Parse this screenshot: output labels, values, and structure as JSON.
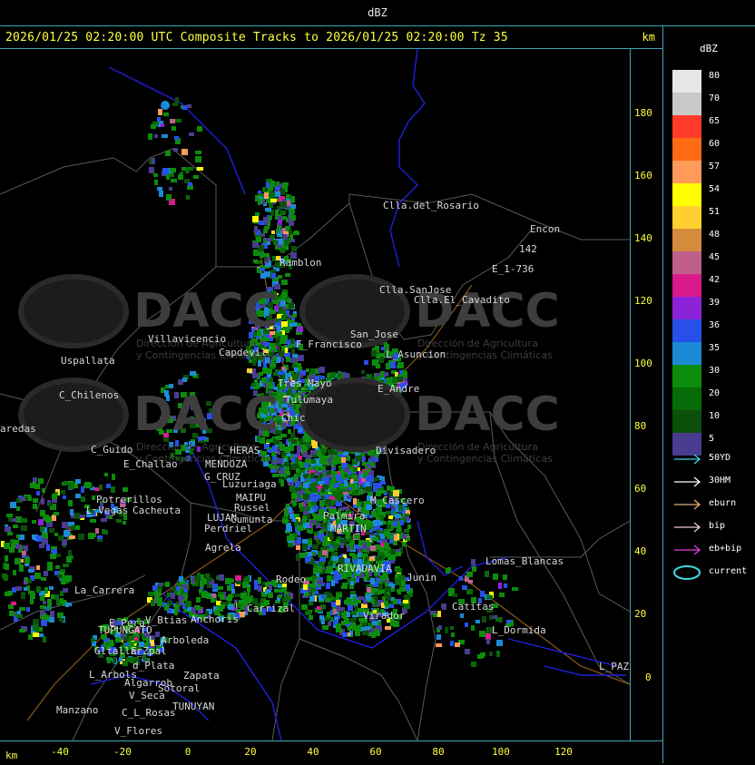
{
  "top_title": "dBZ",
  "header": {
    "text": "2026/01/25 02:20:00 UTC Composite Tracks to 2026/01/25 02:20:00 Tz 35",
    "unit": "km"
  },
  "axes": {
    "x_unit": "km",
    "x_ticks": [
      "-40",
      "-20",
      "0",
      "20",
      "40",
      "60",
      "80",
      "100",
      "120"
    ],
    "y_ticks": [
      "180",
      "160",
      "140",
      "120",
      "100",
      "80",
      "60",
      "40",
      "20",
      "0"
    ]
  },
  "legend": {
    "title": "dBZ",
    "scale": [
      {
        "label": "80",
        "color": "#e6e6e6"
      },
      {
        "label": "70",
        "color": "#c8c8c8"
      },
      {
        "label": "65",
        "color": "#ff3a28"
      },
      {
        "label": "60",
        "color": "#ff6a14"
      },
      {
        "label": "57",
        "color": "#ff9a5a"
      },
      {
        "label": "54",
        "color": "#ffff00"
      },
      {
        "label": "51",
        "color": "#ffd030"
      },
      {
        "label": "48",
        "color": "#d48c3c"
      },
      {
        "label": "45",
        "color": "#c0608a"
      },
      {
        "label": "42",
        "color": "#d81a8c"
      },
      {
        "label": "39",
        "color": "#8c22d8"
      },
      {
        "label": "36",
        "color": "#2650e8"
      },
      {
        "label": "35",
        "color": "#1c8ad6"
      },
      {
        "label": "30",
        "color": "#0c8c0c"
      },
      {
        "label": "20",
        "color": "#066a06"
      },
      {
        "label": "10",
        "color": "#0a500a"
      },
      {
        "label": "5",
        "color": "#4a3c90"
      }
    ],
    "tracks": [
      {
        "label": "50YD",
        "color": "#40d0e0"
      },
      {
        "label": "30HM",
        "color": "#ffffff"
      },
      {
        "label": "eburn",
        "color": "#e0b070"
      },
      {
        "label": "bip",
        "color": "#f0c8e0"
      },
      {
        "label": "eb+bip",
        "color": "#e040e0"
      },
      {
        "label": "current",
        "color": "#40d8e0"
      }
    ]
  },
  "watermarks": [
    {
      "name": "DACC",
      "line1": "Dirección de Agricultura",
      "line2": "y Contingencias Climáticas"
    },
    {
      "name": "DACC",
      "line1": "Dirección de Agricultura",
      "line2": "y Contingencias Climáticas"
    },
    {
      "name": "DACC",
      "line1": "Dirección de Agricultura",
      "line2": "y Contingencias Climáticas"
    },
    {
      "name": "DACC",
      "line1": "Dirección de Agricultura",
      "line2": "y Contingencias Climáticas"
    }
  ],
  "places": [
    "Clla.del_Rosario",
    "Encon",
    "142",
    "E_1-736",
    "Ramblon",
    "Clla.SanJose",
    "Clla.El_Cavadito",
    "Villavicencio",
    "San_Jose",
    "Capdevil",
    "F_Francisco",
    "L_Asuncion",
    "Uspallata",
    "Tres_Mayo",
    "E_Andre",
    "C_Chilenos",
    "Tulumaya",
    "Chic",
    "aredas",
    "C_Guido",
    "L_HERAS",
    "Divisadero",
    "E_Challao",
    "MENDOZA",
    "G_CRUZ",
    "Luzuriaga",
    "Potrerillos",
    "MAIPU",
    "Russel",
    "L_Vegas",
    "Cacheuta",
    "LUJAN",
    "Cumunta",
    "Perdriel",
    "Agrela",
    "M_Cascero",
    "MARTIN",
    "Lomas_Blancas",
    "La_Carrera",
    "Anchoris",
    "Carrizal",
    "E_Pera",
    "V_Btias",
    "TUPUNGATO",
    "L_Arboleda",
    "Gltallar",
    "E_Zpal",
    "L_Arbols",
    "d_Plata",
    "Zapata",
    "Algarrob",
    "Sotoral",
    "V_Seca",
    "TUNUYAN",
    "Manzano",
    "C_L_Rosas",
    "V_Flores",
    "Catitas",
    "L_Dormida",
    "L_PAZ",
    "Virador",
    "RIVADAVIA",
    "Junin",
    "Palmira",
    "Rodeo"
  ]
}
